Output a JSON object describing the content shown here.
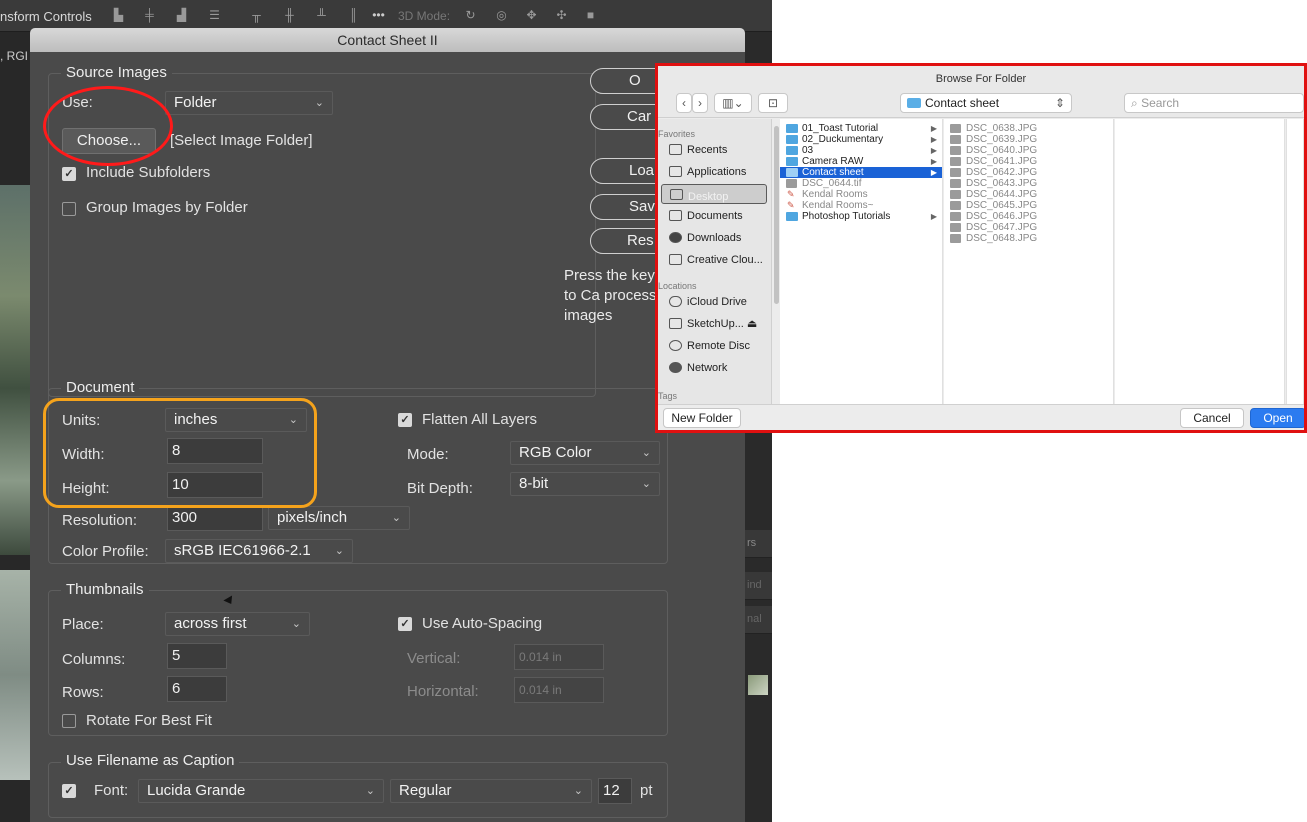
{
  "ps": {
    "toolbar_label": "nsform Controls",
    "toolbar_3d": "3D Mode:",
    "left_strip_label": ", RGI",
    "right_panel": [
      "rs",
      "ind",
      "nal"
    ]
  },
  "contact_sheet": {
    "title": "Contact Sheet II",
    "source": {
      "group_title": "Source Images",
      "use_label": "Use:",
      "use_value": "Folder",
      "choose_button": "Choose...",
      "folder_text": "[Select Image Folder]",
      "include_subfolders": "Include Subfolders",
      "group_by_folder": "Group Images by Folder"
    },
    "buttons": [
      "O",
      "Car",
      "Loa",
      "Sav",
      "Res"
    ],
    "hint": "Press the key to Ca processi images",
    "document": {
      "group_title": "Document",
      "units_label": "Units:",
      "units_value": "inches",
      "width_label": "Width:",
      "width_value": "8",
      "height_label": "Height:",
      "height_value": "10",
      "resolution_label": "Resolution:",
      "resolution_value": "300",
      "resolution_unit": "pixels/inch",
      "profile_label": "Color Profile:",
      "profile_value": "sRGB IEC61966-2.1",
      "flatten_label": "Flatten All Layers",
      "mode_label": "Mode:",
      "mode_value": "RGB Color",
      "bitdepth_label": "Bit Depth:",
      "bitdepth_value": "8-bit"
    },
    "thumbnails": {
      "group_title": "Thumbnails",
      "place_label": "Place:",
      "place_value": "across first",
      "columns_label": "Columns:",
      "columns_value": "5",
      "rows_label": "Rows:",
      "rows_value": "6",
      "rotate_label": "Rotate For Best Fit",
      "autospacing_label": "Use Auto-Spacing",
      "vertical_label": "Vertical:",
      "vertical_value": "0.014 in",
      "horizontal_label": "Horizontal:",
      "horizontal_value": "0.014 in"
    },
    "caption": {
      "group_title": "Use Filename as Caption",
      "font_label": "Font:",
      "font_value": "Lucida Grande",
      "style_value": "Regular",
      "size_value": "12",
      "size_unit": "pt"
    }
  },
  "browse": {
    "title": "Browse For Folder",
    "path": "Contact sheet",
    "search_placeholder": "Search",
    "sidebar": {
      "favorites_label": "Favorites",
      "favorites": [
        "Recents",
        "Applications",
        "Desktop",
        "Documents",
        "Downloads",
        "Creative Clou..."
      ],
      "locations_label": "Locations",
      "locations": [
        "iCloud Drive",
        "SketchUp...",
        "Remote Disc",
        "Network"
      ],
      "tags_label": "Tags"
    },
    "column1": [
      "01_Toast Tutorial",
      "02_Duckumentary",
      "03",
      "Camera RAW",
      "Contact sheet",
      "DSC_0644.tif",
      "Kendal Rooms",
      "Kendal Rooms~",
      "Photoshop Tutorials"
    ],
    "column2": [
      "DSC_0638.JPG",
      "DSC_0639.JPG",
      "DSC_0640.JPG",
      "DSC_0641.JPG",
      "DSC_0642.JPG",
      "DSC_0643.JPG",
      "DSC_0644.JPG",
      "DSC_0645.JPG",
      "DSC_0646.JPG",
      "DSC_0647.JPG",
      "DSC_0648.JPG"
    ],
    "new_folder": "New Folder",
    "cancel": "Cancel",
    "open": "Open"
  },
  "colors": {
    "annotation_red": "#ff1a1a",
    "annotation_orange": "#f5a31c",
    "selection_blue": "#1a62d6"
  }
}
